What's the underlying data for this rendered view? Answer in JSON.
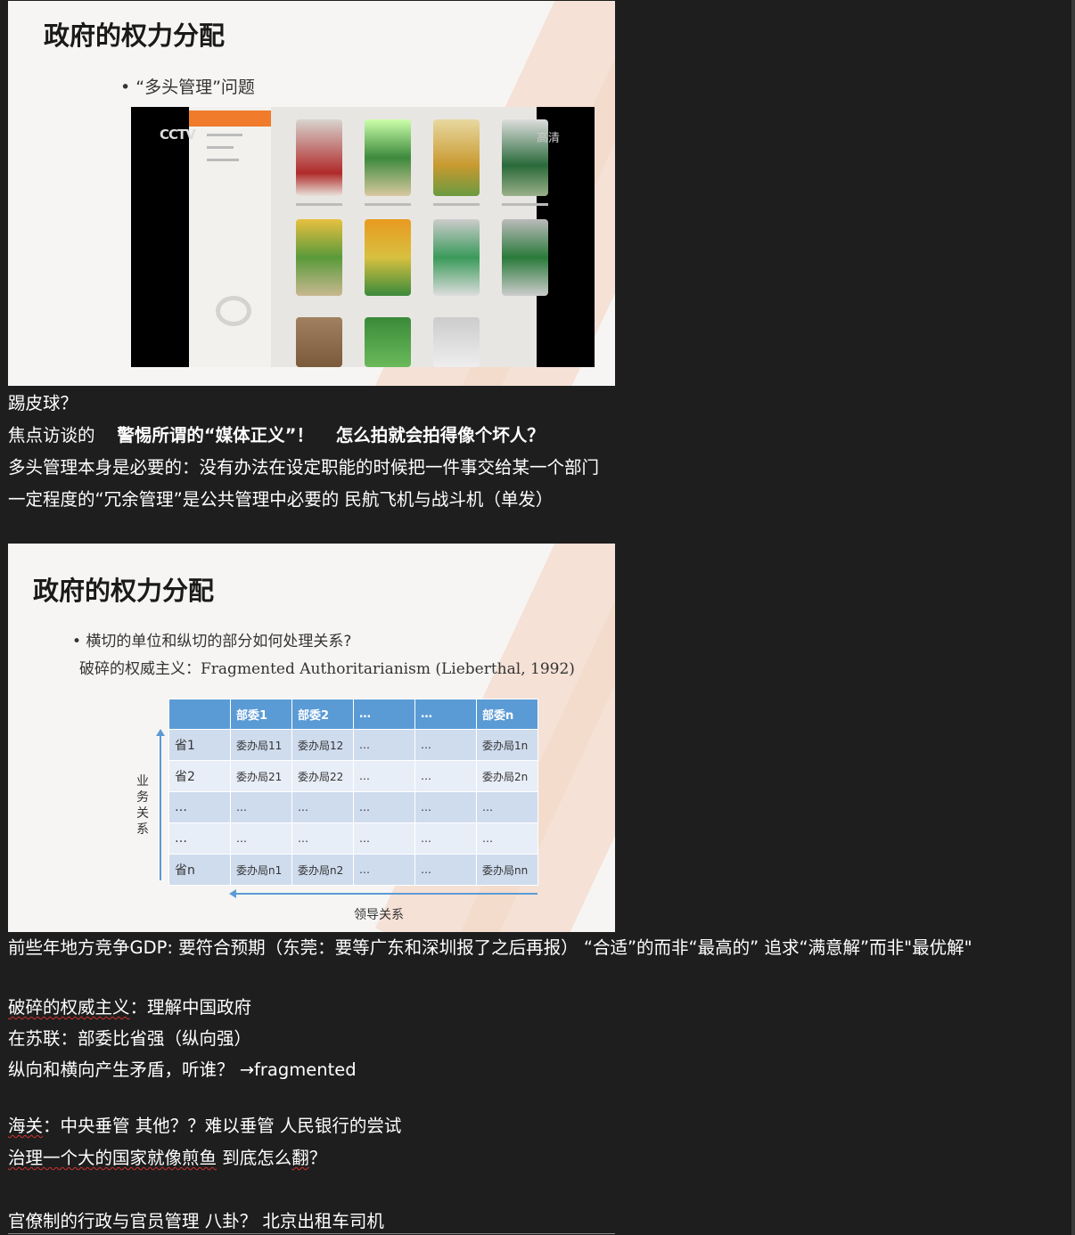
{
  "slide1": {
    "title": "政府的权力分配",
    "bullet": "• “多头管理”问题",
    "video": {
      "channel_logo": "CCTV",
      "quality_badge": "高清"
    }
  },
  "notes1": {
    "line1": "踢皮球？",
    "line2_prefix": "焦点访谈的",
    "line2_bold1": "警惕所谓的“媒体正义”！",
    "line2_bold2": "怎么拍就会拍得像个坏人？",
    "line3": "多头管理本身是必要的：没有办法在设定职能的时候把一件事交给某一个部门",
    "line4": "一定程度的“冗余管理”是公共管理中必要的   民航飞机与战斗机（单发）"
  },
  "slide2": {
    "title": "政府的权力分配",
    "bullet1": "• 横切的单位和纵切的部分如何处理关系?",
    "bullet2": "破碎的权威主义：Fragmented Authoritarianism (Lieberthal, 1992)",
    "vertical_axis_label": "业务关系",
    "horizontal_axis_label": "领导关系",
    "table": {
      "header": [
        "",
        "部委1",
        "部委2",
        "…",
        "…",
        "部委n"
      ],
      "rows": [
        [
          "省1",
          "委办局11",
          "委办局12",
          "…",
          "…",
          "委办局1n"
        ],
        [
          "省2",
          "委办局21",
          "委办局22",
          "…",
          "…",
          "委办局2n"
        ],
        [
          "…",
          "…",
          "…",
          "…",
          "…",
          "…"
        ],
        [
          "…",
          "…",
          "…",
          "…",
          "…",
          "…"
        ],
        [
          "省n",
          "委办局n1",
          "委办局n2",
          "…",
          "…",
          "委办局nn"
        ]
      ]
    }
  },
  "notes2": {
    "line1": "前些年地方竞争GDP:  要符合预期（东莞：要等广东和深圳报了之后再报）   “合适”的而非“最高的”    追求“满意解”而非\"最优解\"",
    "line2_underlined": "破碎的权威主义",
    "line2_rest": "：理解中国政府",
    "line3": "在苏联：部委比省强（纵向强）",
    "line4": "纵向和横向产生矛盾，听谁？  →fragmented",
    "line5_underlined": "海关",
    "line5_rest": "：中央垂管   其他？？难以垂管    人民银行的尝试",
    "line6_underlined": "治理一个大的国家就像煎鱼",
    "line6_rest": "  到底怎么",
    "line6_underlined2": "翻",
    "line6_end": "？",
    "line7": "官僚制的行政与官员管理   八卦？  北京出租车司机"
  }
}
